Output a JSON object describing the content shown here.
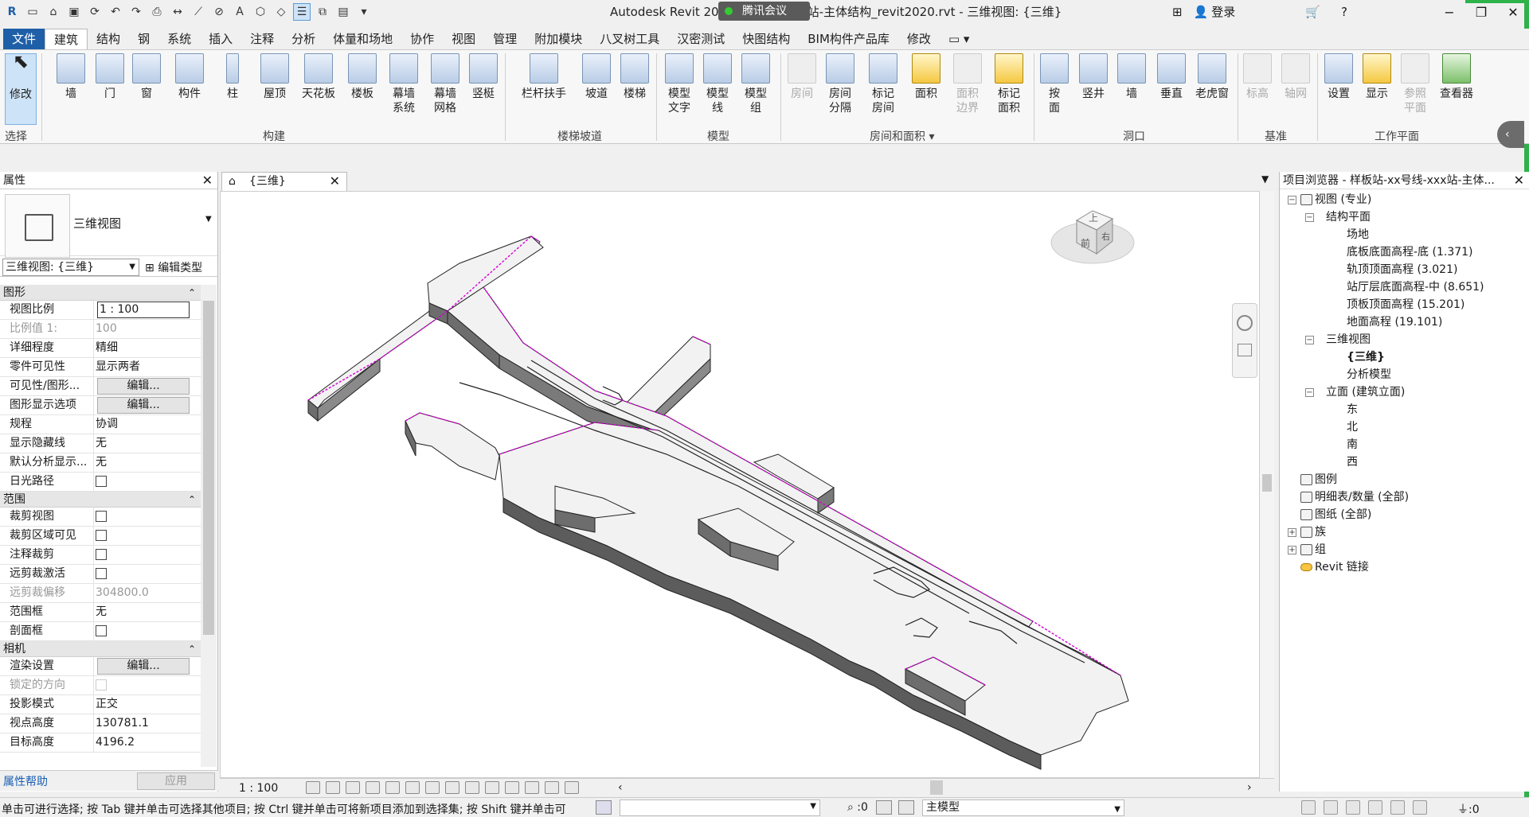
{
  "titlebar": {
    "title": "Autodesk Revit 2020 - 样板线-xxx站-主体结构_revit2020.rvt - 三维视图: {三维}",
    "meeting_label": "腾讯会议",
    "login": "登录"
  },
  "tabs": [
    "文件",
    "建筑",
    "结构",
    "钢",
    "系统",
    "插入",
    "注释",
    "分析",
    "体量和场地",
    "协作",
    "视图",
    "管理",
    "附加模块",
    "八叉树工具",
    "汉密测试",
    "快图结构",
    "BIM构件产品库",
    "修改"
  ],
  "ribbon": {
    "buttons": {
      "modify": "修改",
      "wall": "墙",
      "door": "门",
      "window": "窗",
      "component": "构件",
      "column": "柱",
      "roof": "屋顶",
      "ceiling": "天花板",
      "floor": "楼板",
      "curtain_system": "幕墙\n系统",
      "curtain_grid": "幕墙\n网格",
      "mullion": "竖梃",
      "railing": "栏杆扶手",
      "ramp": "坡道",
      "stair": "楼梯",
      "model_text": "模型\n文字",
      "model_line": "模型\n线",
      "model_group": "模型\n组",
      "room": "房间",
      "room_sep": "房间\n分隔",
      "tag_room": "标记\n房间",
      "area": "面积",
      "area_boundary": "面积\n边界",
      "tag_area": "标记\n面积",
      "by_face": "按\n面",
      "shaft": "竖井",
      "wall_opening": "墙",
      "vertical": "垂直",
      "dormer": "老虎窗",
      "level": "标高",
      "grid": "轴网",
      "set": "设置",
      "show": "显示",
      "ref_plane": "参照\n平面",
      "viewer": "查看器"
    },
    "groups": {
      "select": "选择",
      "build": "构建",
      "circulation": "楼梯坡道",
      "model": "模型",
      "room_area": "房间和面积",
      "opening": "洞口",
      "datum": "基准",
      "work_plane": "工作平面"
    }
  },
  "properties": {
    "header": "属性",
    "type_name": "三维视图",
    "selector": "三维视图: {三维}",
    "edit_type": "编辑类型",
    "sections": {
      "graphics": "图形",
      "extents": "范围",
      "camera": "相机"
    },
    "rows": {
      "view_scale": {
        "k": "视图比例",
        "v": "1 : 100"
      },
      "scale_value": {
        "k": "比例值 1:",
        "v": "100"
      },
      "detail": {
        "k": "详细程度",
        "v": "精细"
      },
      "parts": {
        "k": "零件可见性",
        "v": "显示两者"
      },
      "vg": {
        "k": "可见性/图形...",
        "v": "编辑..."
      },
      "gdo": {
        "k": "图形显示选项",
        "v": "编辑..."
      },
      "discipline": {
        "k": "规程",
        "v": "协调"
      },
      "hidden_lines": {
        "k": "显示隐藏线",
        "v": "无"
      },
      "analysis": {
        "k": "默认分析显示...",
        "v": "无"
      },
      "sun_path": {
        "k": "日光路径",
        "v": ""
      },
      "crop_view": {
        "k": "裁剪视图",
        "v": ""
      },
      "crop_visible": {
        "k": "裁剪区域可见",
        "v": ""
      },
      "annotation_crop": {
        "k": "注释裁剪",
        "v": ""
      },
      "far_clip_active": {
        "k": "远剪裁激活",
        "v": ""
      },
      "far_clip_offset": {
        "k": "远剪裁偏移",
        "v": "304800.0"
      },
      "scope_box": {
        "k": "范围框",
        "v": "无"
      },
      "section_box": {
        "k": "剖面框",
        "v": ""
      },
      "render": {
        "k": "渲染设置",
        "v": "编辑..."
      },
      "lock_orient": {
        "k": "锁定的方向",
        "v": ""
      },
      "projection": {
        "k": "投影模式",
        "v": "正交"
      },
      "eye_elev": {
        "k": "视点高度",
        "v": "130781.1"
      },
      "target_elev": {
        "k": "目标高度",
        "v": "4196.2"
      }
    },
    "help": "属性帮助",
    "apply": "应用"
  },
  "view": {
    "tab": "{三维}",
    "scale": "1 : 100",
    "viewcube": {
      "top": "上",
      "front": "前",
      "right": "右"
    }
  },
  "browser": {
    "header": "项目浏览器 - 样板站-xx号线-xxx站-主体...",
    "nodes": [
      {
        "label": "视图 (专业)",
        "level": 0,
        "toggle": "−",
        "icon": true
      },
      {
        "label": "结构平面",
        "level": 1,
        "toggle": "−"
      },
      {
        "label": "场地",
        "level": 2
      },
      {
        "label": "底板底面高程-底 (1.371)",
        "level": 2
      },
      {
        "label": "轨顶顶面高程 (3.021)",
        "level": 2
      },
      {
        "label": "站厅层底面高程-中 (8.651)",
        "level": 2
      },
      {
        "label": "顶板顶面高程 (15.201)",
        "level": 2
      },
      {
        "label": "地面高程 (19.101)",
        "level": 2
      },
      {
        "label": "三维视图",
        "level": 1,
        "toggle": "−"
      },
      {
        "label": "{三维}",
        "level": 2,
        "bold": true
      },
      {
        "label": "分析模型",
        "level": 2
      },
      {
        "label": "立面 (建筑立面)",
        "level": 1,
        "toggle": "−"
      },
      {
        "label": "东",
        "level": 2
      },
      {
        "label": "北",
        "level": 2
      },
      {
        "label": "南",
        "level": 2
      },
      {
        "label": "西",
        "level": 2
      },
      {
        "label": "图例",
        "level": 0,
        "icon": true
      },
      {
        "label": "明细表/数量 (全部)",
        "level": 0,
        "icon": true
      },
      {
        "label": "图纸 (全部)",
        "level": 0,
        "icon": true
      },
      {
        "label": "族",
        "level": 0,
        "toggle": "+",
        "icon": true
      },
      {
        "label": "组",
        "level": 0,
        "toggle": "+",
        "icon": true
      },
      {
        "label": "Revit 链接",
        "level": 0,
        "icon": "link"
      }
    ]
  },
  "status": {
    "message": "单击可进行选择; 按 Tab 键并单击可选择其他项目; 按 Ctrl 键并单击可将新项目添加到选择集; 按 Shift 键并单击可",
    "zero": ":0",
    "model": "主模型",
    "filter": ":0"
  }
}
